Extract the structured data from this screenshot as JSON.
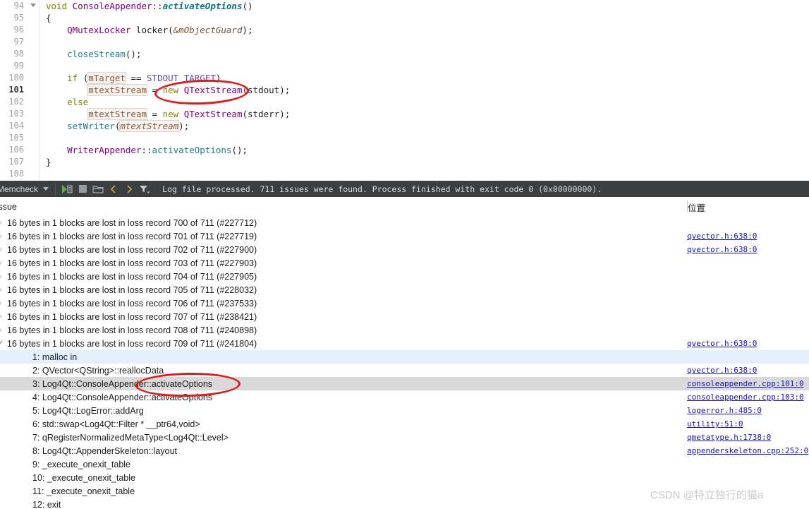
{
  "editor": {
    "lines": [
      {
        "num": "94",
        "fold": true,
        "tokens": [
          {
            "t": "void",
            "c": "kw"
          },
          {
            "t": " ",
            "c": "plain"
          },
          {
            "t": "ConsoleAppender",
            "c": "typ"
          },
          {
            "t": "::",
            "c": "punc"
          },
          {
            "t": "activateOptions",
            "c": "fn"
          },
          {
            "t": "()",
            "c": "punc"
          }
        ]
      },
      {
        "num": "95",
        "fold": false,
        "tokens": [
          {
            "t": "{",
            "c": "punc"
          }
        ]
      },
      {
        "num": "96",
        "fold": false,
        "tokens": [
          {
            "t": "    ",
            "c": "plain"
          },
          {
            "t": "QMutexLocker",
            "c": "typ"
          },
          {
            "t": " ",
            "c": "plain"
          },
          {
            "t": "locker",
            "c": "var"
          },
          {
            "t": "(",
            "c": "punc"
          },
          {
            "t": "&mObjectGuard",
            "c": "param"
          },
          {
            "t": ");",
            "c": "punc"
          }
        ]
      },
      {
        "num": "97",
        "fold": false,
        "tokens": []
      },
      {
        "num": "98",
        "fold": false,
        "tokens": [
          {
            "t": "    ",
            "c": "plain"
          },
          {
            "t": "closeStream",
            "c": "fn2"
          },
          {
            "t": "();",
            "c": "punc"
          }
        ]
      },
      {
        "num": "99",
        "fold": false,
        "tokens": []
      },
      {
        "num": "100",
        "fold": false,
        "tokens": [
          {
            "t": "    ",
            "c": "plain"
          },
          {
            "t": "if",
            "c": "kw"
          },
          {
            "t": " (",
            "c": "punc"
          },
          {
            "t": "mTarget",
            "c": "mem"
          },
          {
            "t": " == ",
            "c": "punc"
          },
          {
            "t": "STDOUT_TARGET",
            "c": "mac"
          },
          {
            "t": ")",
            "c": "punc"
          }
        ]
      },
      {
        "num": "101",
        "fold": false,
        "current": true,
        "tokens": [
          {
            "t": "        ",
            "c": "plain"
          },
          {
            "t": "mtextStream",
            "c": "mem"
          },
          {
            "t": " = ",
            "c": "punc"
          },
          {
            "t": "new",
            "c": "kw"
          },
          {
            "t": " ",
            "c": "plain"
          },
          {
            "t": "QTextStream",
            "c": "typ"
          },
          {
            "t": "(",
            "c": "punc"
          },
          {
            "t": "stdout",
            "c": "var"
          },
          {
            "t": ");",
            "c": "punc"
          }
        ]
      },
      {
        "num": "102",
        "fold": false,
        "tokens": [
          {
            "t": "    ",
            "c": "plain"
          },
          {
            "t": "else",
            "c": "kw"
          }
        ]
      },
      {
        "num": "103",
        "fold": false,
        "tokens": [
          {
            "t": "        ",
            "c": "plain"
          },
          {
            "t": "mtextStream",
            "c": "mem"
          },
          {
            "t": " = ",
            "c": "punc"
          },
          {
            "t": "new",
            "c": "kw"
          },
          {
            "t": " ",
            "c": "plain"
          },
          {
            "t": "QTextStream",
            "c": "typ"
          },
          {
            "t": "(",
            "c": "punc"
          },
          {
            "t": "stderr",
            "c": "var"
          },
          {
            "t": ");",
            "c": "punc"
          }
        ]
      },
      {
        "num": "104",
        "fold": false,
        "tokens": [
          {
            "t": "    ",
            "c": "plain"
          },
          {
            "t": "setWriter",
            "c": "fn2"
          },
          {
            "t": "(",
            "c": "punc"
          },
          {
            "t": "mtextStream",
            "c": "memi"
          },
          {
            "t": ");",
            "c": "punc"
          }
        ]
      },
      {
        "num": "105",
        "fold": false,
        "tokens": []
      },
      {
        "num": "106",
        "fold": false,
        "tokens": [
          {
            "t": "    ",
            "c": "plain"
          },
          {
            "t": "WriterAppender",
            "c": "typ"
          },
          {
            "t": "::",
            "c": "punc"
          },
          {
            "t": "activateOptions",
            "c": "fn2"
          },
          {
            "t": "();",
            "c": "punc"
          }
        ]
      },
      {
        "num": "107",
        "fold": false,
        "tokens": [
          {
            "t": "}",
            "c": "punc"
          }
        ]
      },
      {
        "num": "108",
        "fold": false,
        "tokens": []
      }
    ]
  },
  "toolbar": {
    "analyzer_name": "Memcheck",
    "icons": [
      "run-icon",
      "stop-icon",
      "load-external-log-icon",
      "prev-item-icon",
      "next-item-icon",
      "filter-icon"
    ],
    "status_message": "Log file processed. 711 issues were found. Process finished with exit code 0 (0x00000000)."
  },
  "issues_panel": {
    "columns": {
      "issue": "Issue",
      "location": "位置"
    },
    "rows": [
      {
        "arrow": "collapsed",
        "label": "16 bytes in 1 blocks are lost in loss record 700 of 711 (#227712)",
        "loc": "",
        "bg": "none"
      },
      {
        "arrow": "collapsed",
        "label": "16 bytes in 1 blocks are lost in loss record 701 of 711 (#227719)",
        "loc": "qvector.h:638:0",
        "bg": "none"
      },
      {
        "arrow": "collapsed",
        "label": "16 bytes in 1 blocks are lost in loss record 702 of 711 (#227900)",
        "loc": "qvector.h:638:0",
        "bg": "none"
      },
      {
        "arrow": "collapsed",
        "label": "16 bytes in 1 blocks are lost in loss record 703 of 711 (#227903)",
        "loc": "",
        "bg": "none"
      },
      {
        "arrow": "collapsed",
        "label": "16 bytes in 1 blocks are lost in loss record 704 of 711 (#227905)",
        "loc": "",
        "bg": "none"
      },
      {
        "arrow": "collapsed",
        "label": "16 bytes in 1 blocks are lost in loss record 705 of 711 (#228032)",
        "loc": "",
        "bg": "none"
      },
      {
        "arrow": "collapsed",
        "label": "16 bytes in 1 blocks are lost in loss record 706 of 711 (#237533)",
        "loc": "",
        "bg": "none"
      },
      {
        "arrow": "collapsed",
        "label": "16 bytes in 1 blocks are lost in loss record 707 of 711 (#238421)",
        "loc": "",
        "bg": "none"
      },
      {
        "arrow": "collapsed",
        "label": "16 bytes in 1 blocks are lost in loss record 708 of 711 (#240898)",
        "loc": "",
        "bg": "none"
      },
      {
        "arrow": "expanded",
        "label": "16 bytes in 1 blocks are lost in loss record 709 of 711 (#241804)",
        "loc": "qvector.h:638:0",
        "bg": "none"
      },
      {
        "arrow": "none",
        "label": "1: malloc in",
        "loc": "",
        "bg": "blue",
        "indent": true
      },
      {
        "arrow": "none",
        "label": "2: QVector<QString>::reallocData",
        "loc": "qvector.h:638:0",
        "bg": "none",
        "indent": true
      },
      {
        "arrow": "none",
        "label": "3: Log4Qt::ConsoleAppender::activateOptions",
        "loc": "consoleappender.cpp:101:0",
        "bg": "gray",
        "indent": true
      },
      {
        "arrow": "none",
        "label": "4: Log4Qt::ConsoleAppender::activateOptions",
        "loc": "consoleappender.cpp:103:0",
        "bg": "none",
        "indent": true
      },
      {
        "arrow": "none",
        "label": "5: Log4Qt::LogError::addArg",
        "loc": "logerror.h:485:0",
        "bg": "none",
        "indent": true
      },
      {
        "arrow": "none",
        "label": "6: std::swap<Log4Qt::Filter * __ptr64,void>",
        "loc": "utility:51:0",
        "bg": "none",
        "indent": true
      },
      {
        "arrow": "none",
        "label": "7: qRegisterNormalizedMetaType<Log4Qt::Level>",
        "loc": "qmetatype.h:1738:0",
        "bg": "none",
        "indent": true
      },
      {
        "arrow": "none",
        "label": "8: Log4Qt::AppenderSkeleton::layout",
        "loc": "appenderskeleton.cpp:252:0",
        "bg": "none",
        "indent": true
      },
      {
        "arrow": "none",
        "label": "9: _execute_onexit_table",
        "loc": "",
        "bg": "none",
        "indent": true
      },
      {
        "arrow": "none",
        "label": "10: _execute_onexit_table",
        "loc": "",
        "bg": "none",
        "indent": true
      },
      {
        "arrow": "none",
        "label": "11: _execute_onexit_table",
        "loc": "",
        "bg": "none",
        "indent": true
      },
      {
        "arrow": "none",
        "label": "12: exit",
        "loc": "",
        "bg": "none",
        "indent": true
      }
    ]
  },
  "annotations": {
    "ellipse_code_label": "highlight-new-qtextstream",
    "ellipse_stack_label": "highlight-activateoptions-frame"
  },
  "watermark": {
    "text": "CSDN @特立独行的猫a"
  },
  "colors": {
    "toolbar_bg": "#3c3f41",
    "annotation_red": "#e01b1b",
    "link_blue": "#1414c8",
    "selection_blue": "#e3f1fc",
    "selection_gray": "#d9d9d9"
  }
}
